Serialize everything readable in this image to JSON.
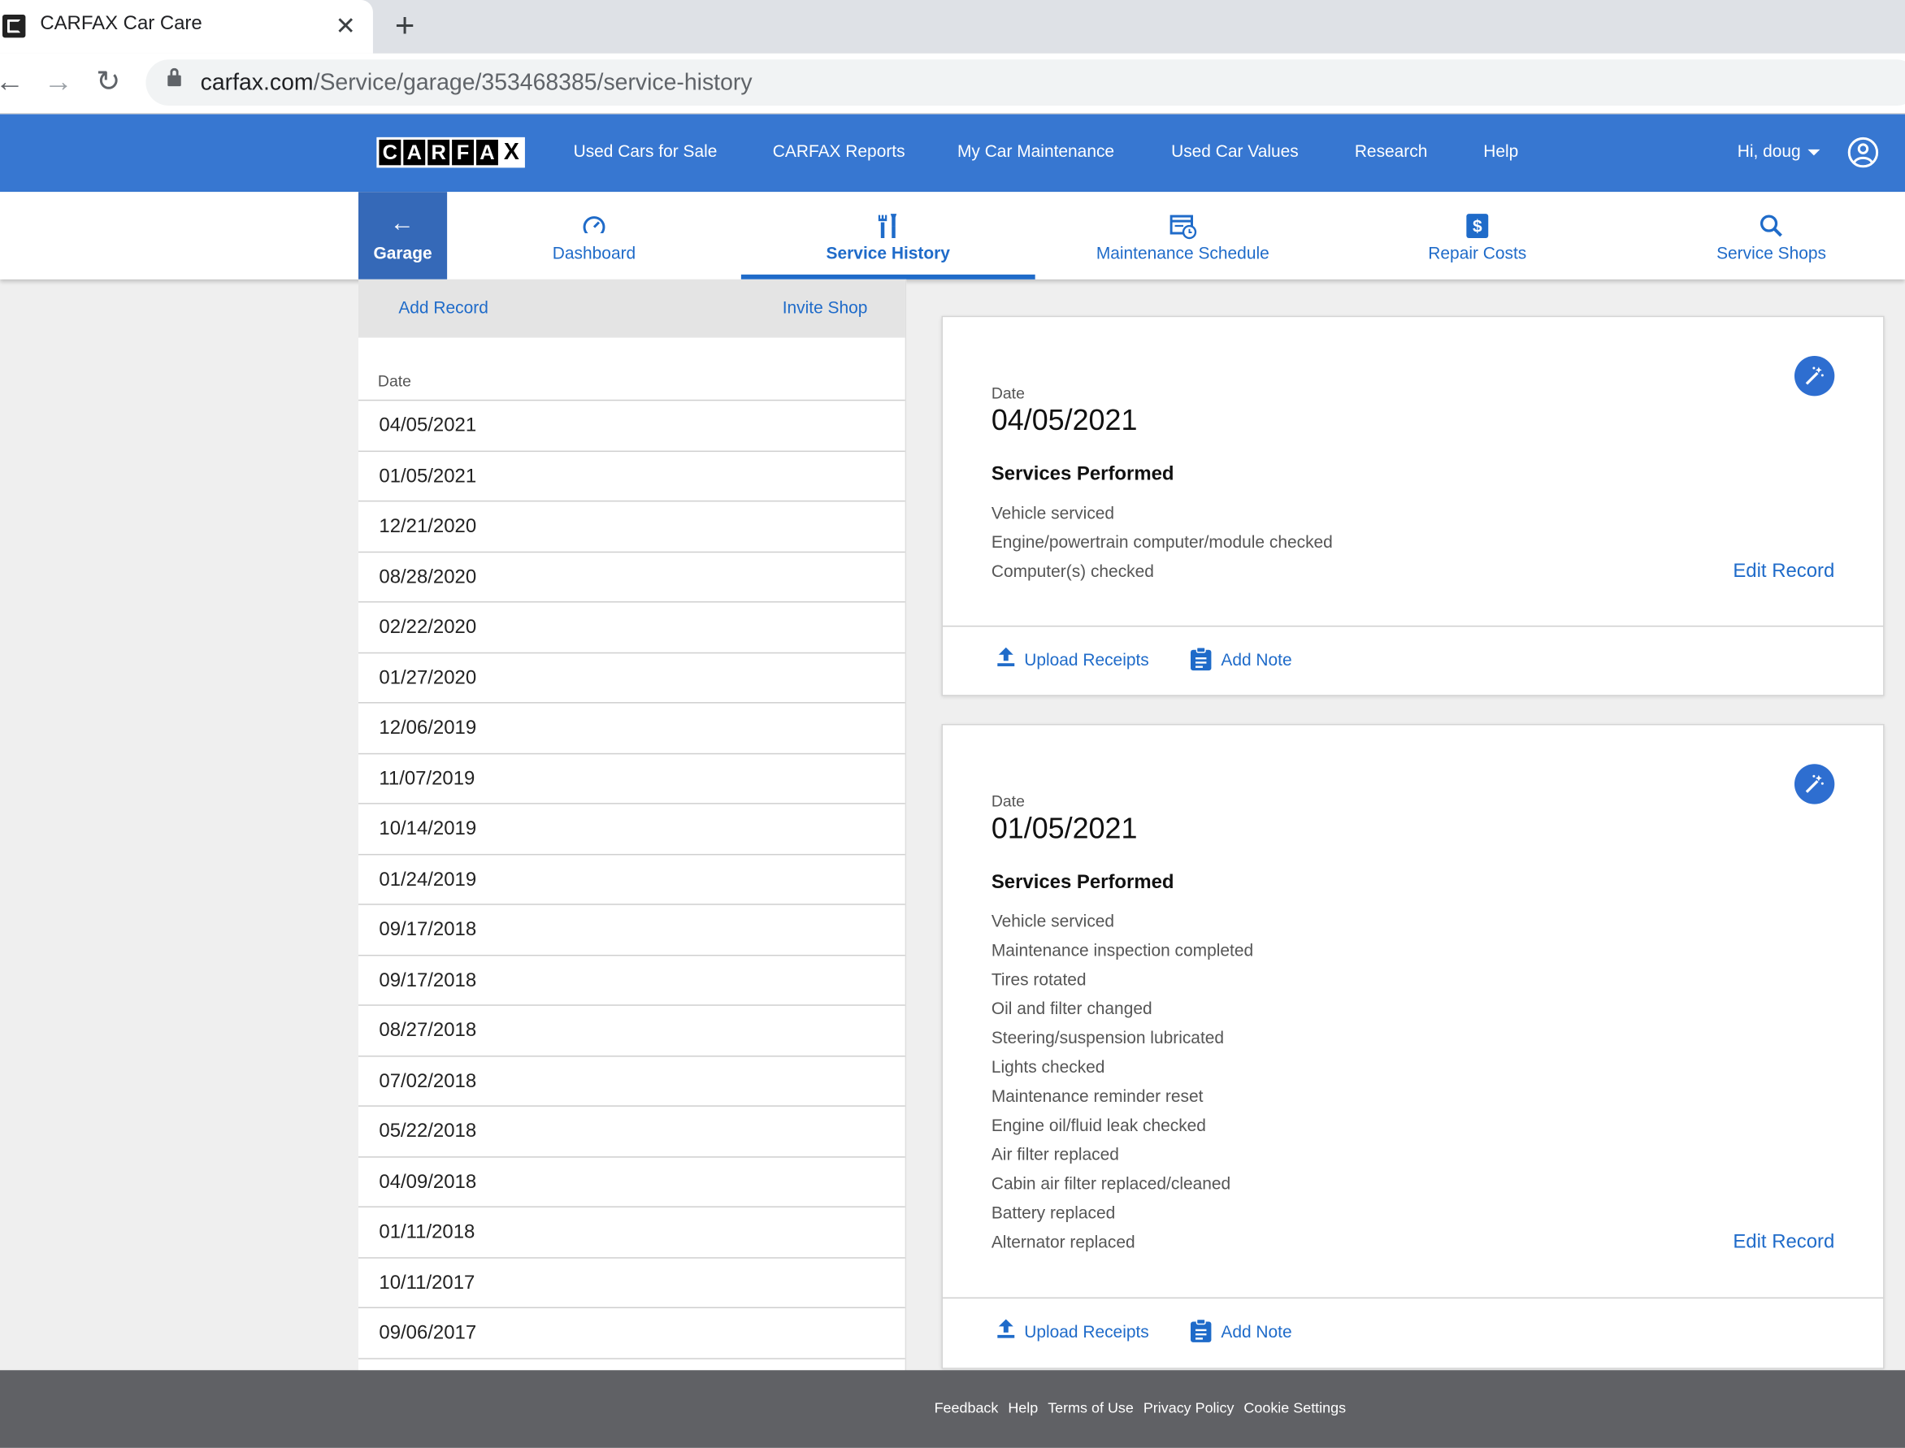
{
  "browser": {
    "tab_title": "CARFAX Car Care",
    "url_domain": "carfax.com",
    "url_path": "/Service/garage/353468385/service-history"
  },
  "header": {
    "logo_letters": [
      "C",
      "A",
      "R",
      "F",
      "A",
      "X"
    ],
    "nav": [
      "Used Cars for Sale",
      "CARFAX Reports",
      "My Car Maintenance",
      "Used Car Values",
      "Research",
      "Help"
    ],
    "user_greeting": "Hi, doug"
  },
  "subnav": {
    "garage_label": "Garage",
    "tabs": [
      "Dashboard",
      "Service History",
      "Maintenance Schedule",
      "Repair Costs",
      "Service Shops"
    ],
    "active_tab": "Service History"
  },
  "list": {
    "add_record": "Add Record",
    "invite_shop": "Invite Shop",
    "header": "Date",
    "dates": [
      "04/05/2021",
      "01/05/2021",
      "12/21/2020",
      "08/28/2020",
      "02/22/2020",
      "01/27/2020",
      "12/06/2019",
      "11/07/2019",
      "10/14/2019",
      "01/24/2019",
      "09/17/2018",
      "09/17/2018",
      "08/27/2018",
      "07/02/2018",
      "05/22/2018",
      "04/09/2018",
      "01/11/2018",
      "10/11/2017",
      "09/06/2017"
    ]
  },
  "records": [
    {
      "date_label": "Date",
      "date": "04/05/2021",
      "services_title": "Services Performed",
      "services": [
        "Vehicle serviced",
        "Engine/powertrain computer/module checked",
        "Computer(s) checked"
      ],
      "edit": "Edit Record",
      "upload": "Upload Receipts",
      "add_note": "Add Note"
    },
    {
      "date_label": "Date",
      "date": "01/05/2021",
      "services_title": "Services Performed",
      "services": [
        "Vehicle serviced",
        "Maintenance inspection completed",
        "Tires rotated",
        "Oil and filter changed",
        "Steering/suspension lubricated",
        "Lights checked",
        "Maintenance reminder reset",
        "Engine oil/fluid leak checked",
        "Air filter replaced",
        "Cabin air filter replaced/cleaned",
        "Battery replaced",
        "Alternator replaced"
      ],
      "edit": "Edit Record",
      "upload": "Upload Receipts",
      "add_note": "Add Note"
    }
  ],
  "footer": [
    "Feedback",
    "Help",
    "Terms of Use",
    "Privacy Policy",
    "Cookie Settings"
  ],
  "colors": {
    "brand_blue": "#3777d1",
    "link_blue": "#1f6bc9",
    "footer_gray": "#606165"
  }
}
